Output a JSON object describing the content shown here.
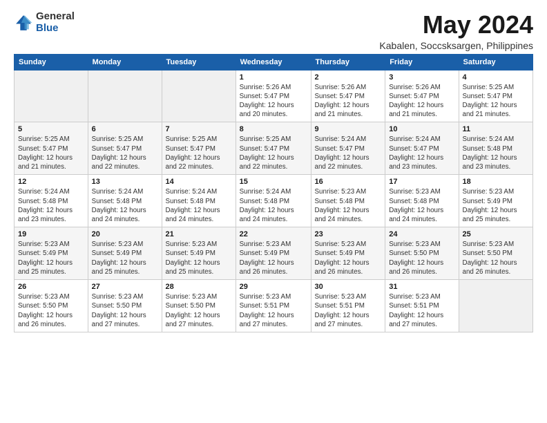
{
  "logo": {
    "general": "General",
    "blue": "Blue"
  },
  "header": {
    "month": "May 2024",
    "location": "Kabalen, Soccsksargen, Philippines"
  },
  "weekdays": [
    "Sunday",
    "Monday",
    "Tuesday",
    "Wednesday",
    "Thursday",
    "Friday",
    "Saturday"
  ],
  "weeks": [
    [
      {
        "day": "",
        "info": ""
      },
      {
        "day": "",
        "info": ""
      },
      {
        "day": "",
        "info": ""
      },
      {
        "day": "1",
        "info": "Sunrise: 5:26 AM\nSunset: 5:47 PM\nDaylight: 12 hours\nand 20 minutes."
      },
      {
        "day": "2",
        "info": "Sunrise: 5:26 AM\nSunset: 5:47 PM\nDaylight: 12 hours\nand 21 minutes."
      },
      {
        "day": "3",
        "info": "Sunrise: 5:26 AM\nSunset: 5:47 PM\nDaylight: 12 hours\nand 21 minutes."
      },
      {
        "day": "4",
        "info": "Sunrise: 5:25 AM\nSunset: 5:47 PM\nDaylight: 12 hours\nand 21 minutes."
      }
    ],
    [
      {
        "day": "5",
        "info": "Sunrise: 5:25 AM\nSunset: 5:47 PM\nDaylight: 12 hours\nand 21 minutes."
      },
      {
        "day": "6",
        "info": "Sunrise: 5:25 AM\nSunset: 5:47 PM\nDaylight: 12 hours\nand 22 minutes."
      },
      {
        "day": "7",
        "info": "Sunrise: 5:25 AM\nSunset: 5:47 PM\nDaylight: 12 hours\nand 22 minutes."
      },
      {
        "day": "8",
        "info": "Sunrise: 5:25 AM\nSunset: 5:47 PM\nDaylight: 12 hours\nand 22 minutes."
      },
      {
        "day": "9",
        "info": "Sunrise: 5:24 AM\nSunset: 5:47 PM\nDaylight: 12 hours\nand 22 minutes."
      },
      {
        "day": "10",
        "info": "Sunrise: 5:24 AM\nSunset: 5:47 PM\nDaylight: 12 hours\nand 23 minutes."
      },
      {
        "day": "11",
        "info": "Sunrise: 5:24 AM\nSunset: 5:48 PM\nDaylight: 12 hours\nand 23 minutes."
      }
    ],
    [
      {
        "day": "12",
        "info": "Sunrise: 5:24 AM\nSunset: 5:48 PM\nDaylight: 12 hours\nand 23 minutes."
      },
      {
        "day": "13",
        "info": "Sunrise: 5:24 AM\nSunset: 5:48 PM\nDaylight: 12 hours\nand 24 minutes."
      },
      {
        "day": "14",
        "info": "Sunrise: 5:24 AM\nSunset: 5:48 PM\nDaylight: 12 hours\nand 24 minutes."
      },
      {
        "day": "15",
        "info": "Sunrise: 5:24 AM\nSunset: 5:48 PM\nDaylight: 12 hours\nand 24 minutes."
      },
      {
        "day": "16",
        "info": "Sunrise: 5:23 AM\nSunset: 5:48 PM\nDaylight: 12 hours\nand 24 minutes."
      },
      {
        "day": "17",
        "info": "Sunrise: 5:23 AM\nSunset: 5:48 PM\nDaylight: 12 hours\nand 24 minutes."
      },
      {
        "day": "18",
        "info": "Sunrise: 5:23 AM\nSunset: 5:49 PM\nDaylight: 12 hours\nand 25 minutes."
      }
    ],
    [
      {
        "day": "19",
        "info": "Sunrise: 5:23 AM\nSunset: 5:49 PM\nDaylight: 12 hours\nand 25 minutes."
      },
      {
        "day": "20",
        "info": "Sunrise: 5:23 AM\nSunset: 5:49 PM\nDaylight: 12 hours\nand 25 minutes."
      },
      {
        "day": "21",
        "info": "Sunrise: 5:23 AM\nSunset: 5:49 PM\nDaylight: 12 hours\nand 25 minutes."
      },
      {
        "day": "22",
        "info": "Sunrise: 5:23 AM\nSunset: 5:49 PM\nDaylight: 12 hours\nand 26 minutes."
      },
      {
        "day": "23",
        "info": "Sunrise: 5:23 AM\nSunset: 5:49 PM\nDaylight: 12 hours\nand 26 minutes."
      },
      {
        "day": "24",
        "info": "Sunrise: 5:23 AM\nSunset: 5:50 PM\nDaylight: 12 hours\nand 26 minutes."
      },
      {
        "day": "25",
        "info": "Sunrise: 5:23 AM\nSunset: 5:50 PM\nDaylight: 12 hours\nand 26 minutes."
      }
    ],
    [
      {
        "day": "26",
        "info": "Sunrise: 5:23 AM\nSunset: 5:50 PM\nDaylight: 12 hours\nand 26 minutes."
      },
      {
        "day": "27",
        "info": "Sunrise: 5:23 AM\nSunset: 5:50 PM\nDaylight: 12 hours\nand 27 minutes."
      },
      {
        "day": "28",
        "info": "Sunrise: 5:23 AM\nSunset: 5:50 PM\nDaylight: 12 hours\nand 27 minutes."
      },
      {
        "day": "29",
        "info": "Sunrise: 5:23 AM\nSunset: 5:51 PM\nDaylight: 12 hours\nand 27 minutes."
      },
      {
        "day": "30",
        "info": "Sunrise: 5:23 AM\nSunset: 5:51 PM\nDaylight: 12 hours\nand 27 minutes."
      },
      {
        "day": "31",
        "info": "Sunrise: 5:23 AM\nSunset: 5:51 PM\nDaylight: 12 hours\nand 27 minutes."
      },
      {
        "day": "",
        "info": ""
      }
    ]
  ]
}
